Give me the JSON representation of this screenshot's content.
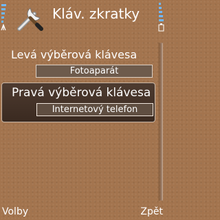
{
  "header": {
    "title": "Kláv. zkratky",
    "app_icon": "wrench-screwdriver-icon",
    "signal_icon": "signal-strength-icon",
    "battery_icon": "battery-level-icon"
  },
  "settings": [
    {
      "label": "Levá výběrová klávesa",
      "value": "Fotoaparát",
      "selected": false
    },
    {
      "label": "Pravá výběrová klávesa",
      "value": "Internetový telefon",
      "selected": true
    }
  ],
  "softkeys": {
    "left": "Volby",
    "right": "Zpět"
  },
  "colors": {
    "background": "#a3744e",
    "highlight": "#3f2f25"
  }
}
